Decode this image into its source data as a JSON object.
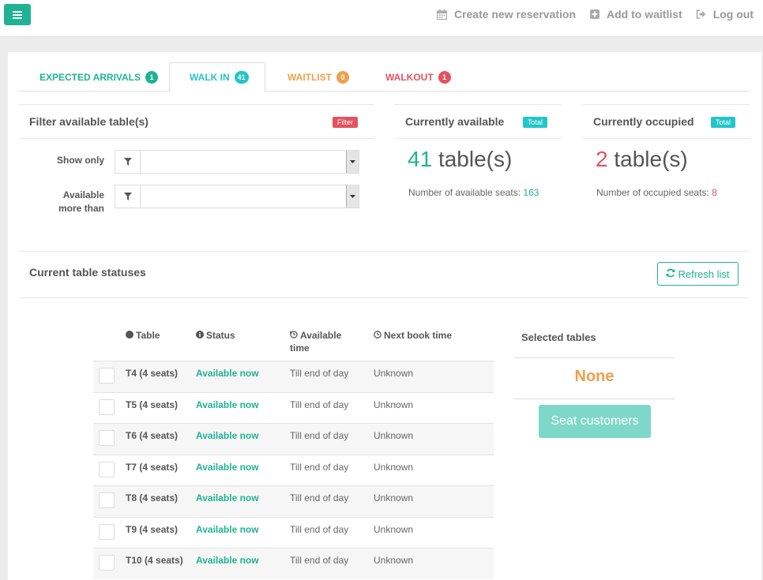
{
  "colors": {
    "accent": "#1fb394",
    "info": "#23c6c8",
    "warning": "#f0a04b",
    "danger": "#e4525f"
  },
  "topnav": {
    "create": {
      "label": "Create new reservation",
      "icon": "calendar-icon"
    },
    "waitlist": {
      "label": "Add to waitlist",
      "icon": "plus-square-icon"
    },
    "logout": {
      "label": "Log out",
      "icon": "sign-out-icon"
    }
  },
  "tabs": [
    {
      "label": "EXPECTED ARRIVALS",
      "count": "1",
      "active": false
    },
    {
      "label": "WALK IN",
      "count": "41",
      "active": true
    },
    {
      "label": "WAITLIST",
      "count": "0",
      "active": false
    },
    {
      "label": "WALKOUT",
      "count": "1",
      "active": false
    }
  ],
  "filter": {
    "title": "Filter available table(s)",
    "tag": "Filter",
    "show_only_label": "Show only",
    "available_label_line1": "Available",
    "available_label_line2": "more than"
  },
  "available": {
    "title": "Currently available",
    "tag": "Total",
    "count": "41",
    "unit": "table(s)",
    "seats_label": "Number of available seats:",
    "seats": "163"
  },
  "occupied": {
    "title": "Currently occupied",
    "tag": "Total",
    "count": "2",
    "unit": "table(s)",
    "seats_label": "Number of occupied seats:",
    "seats": "8"
  },
  "statuses": {
    "title": "Current table statuses",
    "refresh_label": "Refresh list",
    "headers": {
      "table": "Table",
      "status": "Status",
      "available_line1": "Available",
      "available_line2": "time",
      "next": "Next book time"
    },
    "rows": [
      {
        "table": "T4 (4 seats)",
        "status": "Available now",
        "available": "Till end of day",
        "next": "Unknown"
      },
      {
        "table": "T5 (4 seats)",
        "status": "Available now",
        "available": "Till end of day",
        "next": "Unknown"
      },
      {
        "table": "T6 (4 seats)",
        "status": "Available now",
        "available": "Till end of day",
        "next": "Unknown"
      },
      {
        "table": "T7 (4 seats)",
        "status": "Available now",
        "available": "Till end of day",
        "next": "Unknown"
      },
      {
        "table": "T8 (4 seats)",
        "status": "Available now",
        "available": "Till end of day",
        "next": "Unknown"
      },
      {
        "table": "T9 (4 seats)",
        "status": "Available now",
        "available": "Till end of day",
        "next": "Unknown"
      },
      {
        "table": "T10 (4 seats)",
        "status": "Available now",
        "available": "Till end of day",
        "next": "Unknown"
      }
    ]
  },
  "selected": {
    "title": "Selected tables",
    "value": "None",
    "seat_button": "Seat customers"
  }
}
